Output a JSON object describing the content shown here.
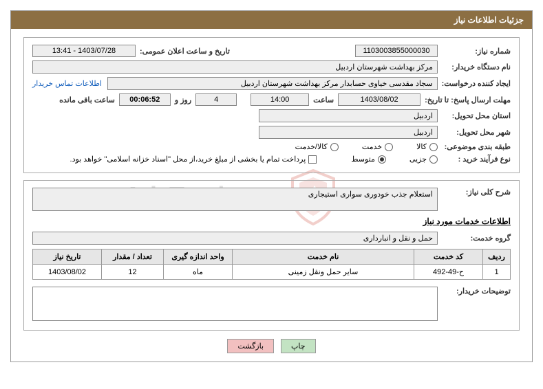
{
  "title": "جزئیات اطلاعات نیاز",
  "fields": {
    "need_no_label": "شماره نیاز:",
    "need_no": "1103003855000030",
    "announce_label": "تاریخ و ساعت اعلان عمومی:",
    "announce_value": "1403/07/28 - 13:41",
    "buyer_org_label": "نام دستگاه خریدار:",
    "buyer_org": "مرکز بهداشت شهرستان اردبیل",
    "requester_label": "ایجاد کننده درخواست:",
    "requester": "سجاد مقدسی خیاوی حسابدار مرکز بهداشت شهرستان اردبیل",
    "contact_link": "اطلاعات تماس خریدار",
    "deadline_label": "مهلت ارسال پاسخ: تا تاریخ:",
    "deadline_date": "1403/08/02",
    "time_label": "ساعت",
    "deadline_time": "14:00",
    "remaining_days": "4",
    "days_and_label": "روز و",
    "remaining_timer": "00:06:52",
    "remaining_label": "ساعت باقی مانده",
    "province_label": "استان محل تحویل:",
    "province": "اردبیل",
    "city_label": "شهر محل تحویل:",
    "city": "اردبیل",
    "subject_cat_label": "طبقه بندی موضوعی:",
    "radio_kala": "کالا",
    "radio_khedmat": "خدمت",
    "radio_kala_khedmat": "کالا/خدمت",
    "purchase_type_label": "نوع فرآیند خرید :",
    "radio_jozei": "جزیی",
    "radio_motavaset": "متوسط",
    "checkbox_note": "پرداخت تمام یا بخشی از مبلغ خرید،از محل \"اسناد خزانه اسلامی\" خواهد بود.",
    "need_desc_label": "شرح کلی نیاز:",
    "need_desc": "استعلام جذب خودوری سواری استیجاری",
    "service_info_header": "اطلاعات خدمات مورد نیاز",
    "service_group_label": "گروه خدمت:",
    "service_group": "حمل و نقل و انبارداری",
    "buyer_notes_label": "توضیحات خریدار:",
    "buyer_notes": ""
  },
  "table": {
    "headers": {
      "row": "ردیف",
      "code": "کد خدمت",
      "name": "نام خدمت",
      "unit": "واحد اندازه گیری",
      "qty": "تعداد / مقدار",
      "date": "تاریخ نیاز"
    },
    "rows": [
      {
        "row": "1",
        "code": "ح-49-492",
        "name": "سایر حمل ونقل زمینی",
        "unit": "ماه",
        "qty": "12",
        "date": "1403/08/02"
      }
    ]
  },
  "buttons": {
    "print": "چاپ",
    "back": "بازگشت"
  },
  "watermark": "AriaTender.net"
}
